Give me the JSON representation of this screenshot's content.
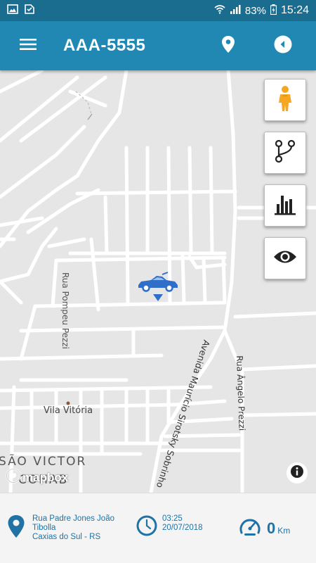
{
  "status": {
    "battery": "83%",
    "time": "15:24"
  },
  "appbar": {
    "title": "AAA-5555"
  },
  "map": {
    "streets": [
      "Rua Pompeu Pezzi",
      "Avenida Maurício Sirotsky Sobrinho",
      "Rua Ângelo Prezzi"
    ],
    "places": [
      "Vila Vitória",
      "SÃO VICTOR",
      "COHAB"
    ],
    "attribution": "mapbox",
    "accent": "#2f6fc9"
  },
  "footer": {
    "address_line1": "Rua Padre Jones João",
    "address_line2": "Tibolla",
    "address_line3": "Caxias do Sul - RS",
    "time": "03:25",
    "date": "20/07/2018",
    "speed": "0",
    "speed_unit": "Km"
  },
  "icons": {
    "menu": "menu-icon",
    "location": "location-pin-icon",
    "back": "back-arrow-icon",
    "streetview": "pegman-icon",
    "route": "route-icon",
    "chart": "bar-chart-icon",
    "eye": "eye-icon",
    "info": "info-icon"
  }
}
